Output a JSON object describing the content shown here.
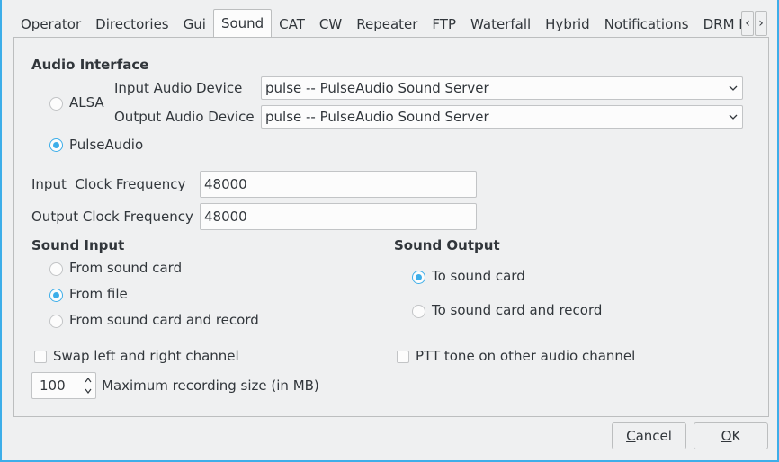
{
  "tabs": [
    "Operator",
    "Directories",
    "Gui",
    "Sound",
    "CAT",
    "CW",
    "Repeater",
    "FTP",
    "Waterfall",
    "Hybrid",
    "Notifications",
    "DRM P"
  ],
  "active_tab": "Sound",
  "tab_scroll": {
    "left": "‹",
    "right": "›"
  },
  "audio_interface": {
    "title": "Audio Interface",
    "options": [
      {
        "label": "ALSA",
        "selected": false
      },
      {
        "label": "PulseAudio",
        "selected": true
      }
    ],
    "input_device_label": "Input Audio Device",
    "input_device_value": "pulse -- PulseAudio Sound Server",
    "output_device_label": "Output Audio Device",
    "output_device_value": "pulse -- PulseAudio Sound Server"
  },
  "clock": {
    "input_label": "Input  Clock Frequency",
    "input_value": "48000",
    "output_label": "Output Clock Frequency",
    "output_value": "48000"
  },
  "sound_input": {
    "title": "Sound Input",
    "options": [
      {
        "label": "From sound card",
        "selected": false
      },
      {
        "label": "From file",
        "selected": true
      },
      {
        "label": "From sound card and record",
        "selected": false
      }
    ]
  },
  "sound_output": {
    "title": "Sound Output",
    "options": [
      {
        "label": "To sound card",
        "selected": true
      },
      {
        "label": "To sound card and record",
        "selected": false
      }
    ]
  },
  "swap_channels": {
    "label": "Swap left and right channel",
    "checked": false
  },
  "ptt_tone": {
    "label": "PTT tone on other audio channel",
    "checked": false
  },
  "max_recording": {
    "value": "100",
    "label": "Maximum recording size (in MB)"
  },
  "buttons": {
    "cancel_mnemonic": "C",
    "cancel_rest": "ancel",
    "ok_mnemonic": "O",
    "ok_rest": "K"
  },
  "colors": {
    "accent": "#3daee9",
    "background": "#eff0f1",
    "text": "#31363b"
  }
}
